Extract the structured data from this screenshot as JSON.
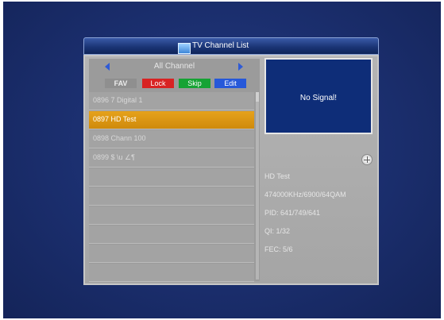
{
  "window": {
    "title": "TV Channel List"
  },
  "navigator": {
    "label": "All Channel"
  },
  "buttons": {
    "fav": "FAV",
    "lock": "Lock",
    "skip": "Skip",
    "edit": "Edit"
  },
  "channels": [
    {
      "label": "0896 7 Digital 1"
    },
    {
      "label": "0897 HD Test"
    },
    {
      "label": "0898 Chann 100"
    },
    {
      "label": "0899 $ \\u ∠¶"
    }
  ],
  "preview": {
    "status": "No Signal!"
  },
  "info": {
    "name": "HD Test",
    "freq": "474000KHz/6900/64QAM",
    "pid": "PID: 641/749/641",
    "qi": "QI: 1/32",
    "fec": "FEC: 5/6"
  },
  "colors": {
    "selected": "#d9941a",
    "fav": "#8f8f8f",
    "lock": "#d82323",
    "skip": "#16a334",
    "edit": "#2658d9",
    "background": "#1b2f6e"
  }
}
